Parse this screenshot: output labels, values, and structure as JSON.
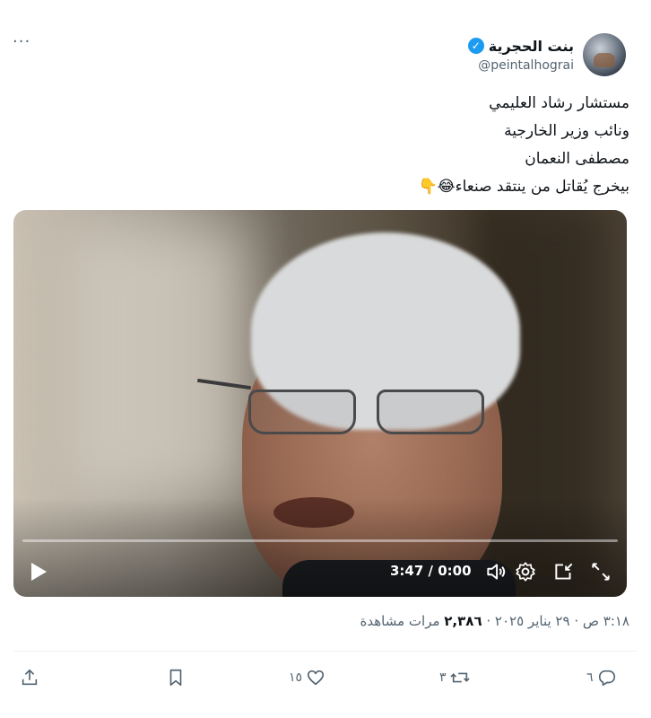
{
  "tweet": {
    "more_label": "···",
    "author": {
      "display_name": "بنت الحجرية",
      "handle": "@peintalhograi",
      "verified_mark": "✓",
      "avatar_icon": "avatar"
    },
    "text_lines": [
      "مستشار رشاد العليمي",
      "ونائب وزير الخارجية",
      "مصطفى النعمان",
      "بيخرج يُقاتل من ينتقد صنعاء😂👇"
    ],
    "video": {
      "time": "3:47 / 0:00",
      "progress": 0,
      "controls": [
        "play-icon",
        "volume-icon",
        "settings-icon",
        "picture-in-picture-icon",
        "fullscreen-icon"
      ]
    },
    "meta": {
      "timestamp": "٣:١٨ ص · ٢٩ يناير ٢٠٢٥ · ",
      "views": "٢,٣٨٦",
      "views_label": " مرات مشاهدة"
    },
    "actions": {
      "replies": "٦",
      "reposts": "٣",
      "likes": "١٥"
    },
    "colors": {
      "accent": "#1d9bf0",
      "secondary_text": "#536471",
      "primary_text": "#0f1419"
    }
  }
}
